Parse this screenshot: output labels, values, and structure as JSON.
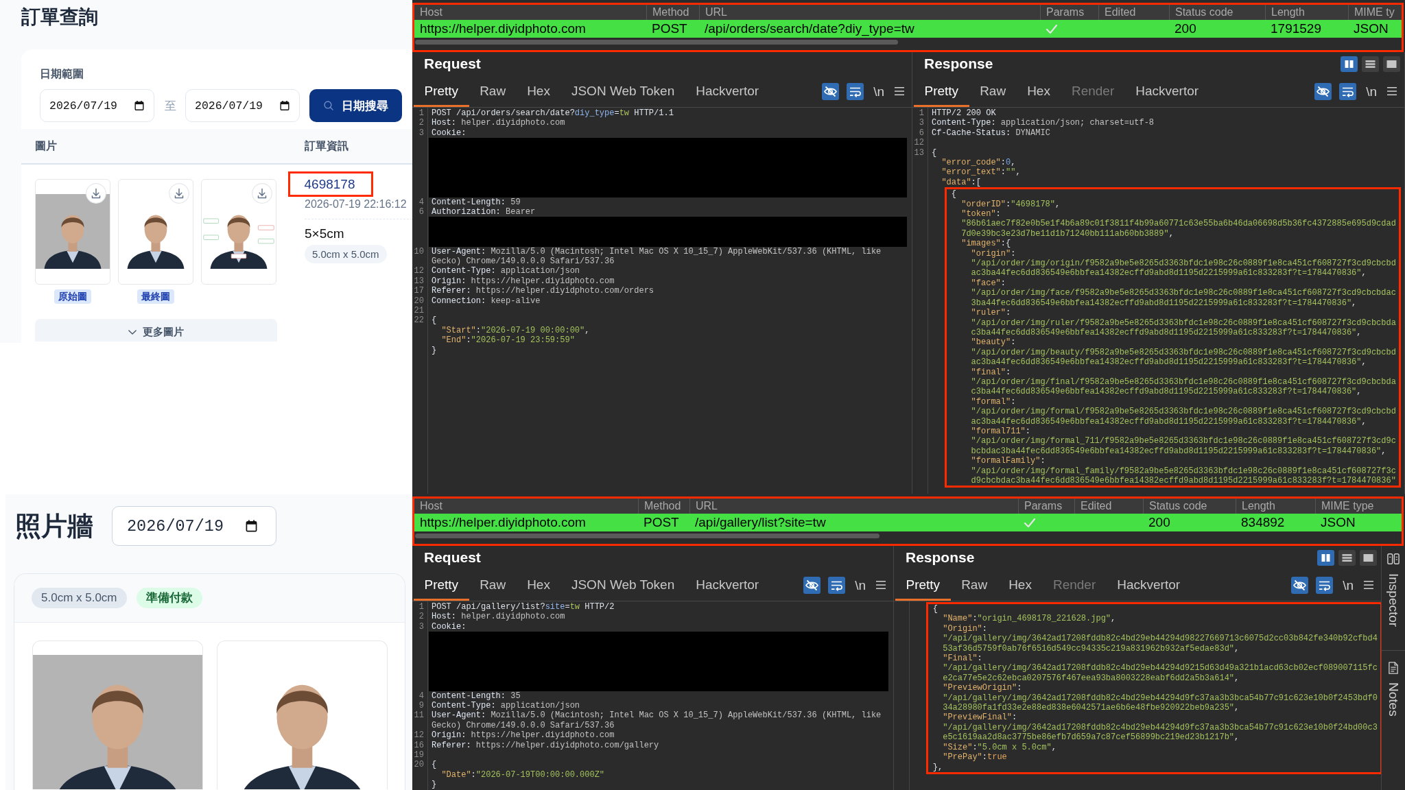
{
  "order_query": {
    "title": "訂單查詢",
    "date_range": {
      "label": "日期範圍",
      "from": "2026/07/19",
      "separator": "至",
      "to": "2026/07/19"
    },
    "search_button": "日期搜尋",
    "table": {
      "columns": [
        "圖片",
        "訂單資訊"
      ],
      "rows": [
        {
          "images": [
            {
              "kind": "original",
              "label": "原始圖"
            },
            {
              "kind": "final",
              "label": "最終圖"
            },
            {
              "kind": "ruler"
            }
          ],
          "more_button": "更多圖片",
          "order_id": "4698178",
          "highlighted": true,
          "created": "2026-07-19 22:16:12",
          "size": "5×5cm",
          "size_tag": "5.0cm x 5.0cm"
        }
      ]
    }
  },
  "photo_wall": {
    "title": "照片牆",
    "date": "2026/07/19",
    "cards": [
      {
        "size_tag": "5.0cm x 5.0cm",
        "status": "準備付款",
        "photos": [
          {
            "kind": "original"
          },
          {
            "kind": "final"
          }
        ]
      }
    ]
  },
  "captures": [
    {
      "table": {
        "highlighted": true,
        "columns": [
          "Host",
          "Method",
          "URL",
          "Params",
          "Edited",
          "Status code",
          "Length",
          "MIME ty"
        ],
        "row": {
          "color": "#44e044",
          "host": "https://helper.diyidphoto.com",
          "method": "POST",
          "url": "/api/orders/search/date?diy_type=tw",
          "params": true,
          "status": "200",
          "length": "1791529",
          "mime": "JSON"
        }
      },
      "request": {
        "title": "Request",
        "tabs": [
          {
            "label": "Pretty",
            "selected": true
          },
          {
            "label": "Raw",
            "selected": false
          },
          {
            "label": "Hex",
            "selected": false
          },
          {
            "label": "JSON Web Token",
            "selected": false
          },
          {
            "label": "Hackvertor",
            "selected": false
          }
        ],
        "toggles": [
          {
            "kind": "hide",
            "on": true
          },
          {
            "kind": "wrap",
            "on": true
          },
          {
            "kind": "newline",
            "label": "\\n",
            "on": false
          }
        ],
        "lines": [
          {
            "kind": "request_line",
            "num": "1",
            "text": "POST /api/orders/search/date?diy_type=tw HTTP/1.1"
          },
          {
            "kind": "header",
            "num": "2",
            "text": "Host: helper.diyidphoto.com"
          },
          {
            "kind": "header",
            "num": "3",
            "text": "Cookie:"
          },
          {
            "kind": "redaction",
            "tall": true
          },
          {
            "kind": "header",
            "num": "4",
            "text": "Content-Length: 59"
          },
          {
            "kind": "header",
            "num": "6",
            "text": "Authorization: Bearer"
          },
          {
            "kind": "redaction",
            "tall": false
          },
          {
            "kind": "header",
            "num": "10",
            "text": "User-Agent: Mozilla/5.0 (Macintosh; Intel Mac OS X 10_15_7) AppleWebKit/537.36 (KHTML, like Gecko) Chrome/149.0.0.0 Safari/537.36"
          },
          {
            "kind": "header",
            "num": "12",
            "text": "Content-Type: application/json"
          },
          {
            "kind": "header",
            "num": "13",
            "text": "Origin: https://helper.diyidphoto.com"
          },
          {
            "kind": "header",
            "num": "17",
            "text": "Referer: https://helper.diyidphoto.com/orders"
          },
          {
            "kind": "header",
            "num": "20",
            "text": "Connection: keep-alive"
          },
          {
            "kind": "blank",
            "num": "21"
          },
          {
            "kind": "json",
            "num": "22",
            "text": "{",
            "children": [
              {
                "kind": "json",
                "text": "\"Start\":\"2026-07-19 00:00:00\","
              },
              {
                "kind": "json",
                "text": "\"End\":\"2026-07-19 23:59:59\""
              }
            ],
            "close": "}"
          }
        ]
      },
      "response": {
        "title": "Response",
        "view_modes": [
          {
            "kind": "columns",
            "selected": true
          },
          {
            "kind": "rows",
            "selected": false
          },
          {
            "kind": "single",
            "selected": false
          }
        ],
        "tabs": [
          {
            "label": "Pretty",
            "selected": true,
            "disabled": false
          },
          {
            "label": "Raw",
            "selected": false,
            "disabled": false
          },
          {
            "label": "Hex",
            "selected": false,
            "disabled": false
          },
          {
            "label": "Render",
            "selected": false,
            "disabled": true
          },
          {
            "label": "Hackvertor",
            "selected": false,
            "disabled": false
          }
        ],
        "toggles": [
          {
            "kind": "hide",
            "on": true
          },
          {
            "kind": "wrap",
            "on": true
          },
          {
            "kind": "newline",
            "label": "\\n",
            "on": false
          }
        ],
        "lines": [
          {
            "kind": "status_line",
            "num": "1",
            "text": "HTTP/2 200 OK"
          },
          {
            "kind": "header",
            "num": "3",
            "text": "Content-Type: application/json; charset=utf-8"
          },
          {
            "kind": "header",
            "num": "6",
            "text": "Cf-Cache-Status: DYNAMIC"
          },
          {
            "kind": "blank",
            "num": "12"
          },
          {
            "kind": "json",
            "num": "13",
            "text": "{",
            "children": [
              {
                "kind": "json",
                "text": "\"error_code\":0,"
              },
              {
                "kind": "json",
                "text": "\"error_text\":\"\","
              },
              {
                "kind": "json",
                "text": "\"data\":[",
                "children": [
                  {
                    "kind": "json",
                    "text": "{",
                    "highlighted": true,
                    "children": [
                      {
                        "kind": "json",
                        "text": "\"orderID\":\"4698178\","
                      },
                      {
                        "kind": "json",
                        "text": "\"token\":"
                      },
                      {
                        "kind": "json",
                        "text": "\"86b61aec7f82e0b5e1f4b6a89c01f3811f4b99a60771c63e55ba6b46da06698d5b36fc4372885e695d9cdad7d0e39bc3e23d7be11d1b71240bb111ab60bb3889\","
                      },
                      {
                        "kind": "json",
                        "text": "\"images\":{",
                        "children": [
                          {
                            "kind": "json",
                            "text": "\"origin\":"
                          },
                          {
                            "kind": "json",
                            "text": "\"/api/order/img/origin/f9582a9be5e8265d3363bfdc1e98c26c0889f1e8ca451cf608727f3cd9cbcbdac3ba44fec6dd836549e6bbfea14382ecffd9abd8d1195d2215999a61c833283f?t=1784470836\","
                          },
                          {
                            "kind": "json",
                            "text": "\"face\":"
                          },
                          {
                            "kind": "json",
                            "text": "\"/api/order/img/face/f9582a9be5e8265d3363bfdc1e98c26c0889f1e8ca451cf608727f3cd9cbcbdac3ba44fec6dd836549e6bbfea14382ecffd9abd8d1195d2215999a61c833283f?t=1784470836\","
                          },
                          {
                            "kind": "json",
                            "text": "\"ruler\":"
                          },
                          {
                            "kind": "json",
                            "text": "\"/api/order/img/ruler/f9582a9be5e8265d3363bfdc1e98c26c0889f1e8ca451cf608727f3cd9cbcbdac3ba44fec6dd836549e6bbfea14382ecffd9abd8d1195d2215999a61c833283f?t=1784470836\","
                          },
                          {
                            "kind": "json",
                            "text": "\"beauty\":"
                          },
                          {
                            "kind": "json",
                            "text": "\"/api/order/img/beauty/f9582a9be5e8265d3363bfdc1e98c26c0889f1e8ca451cf608727f3cd9cbcbdac3ba44fec6dd836549e6bbfea14382ecffd9abd8d1195d2215999a61c833283f?t=1784470836\","
                          },
                          {
                            "kind": "json",
                            "text": "\"final\":"
                          },
                          {
                            "kind": "json",
                            "text": "\"/api/order/img/final/f9582a9be5e8265d3363bfdc1e98c26c0889f1e8ca451cf608727f3cd9cbcbdac3ba44fec6dd836549e6bbfea14382ecffd9abd8d1195d2215999a61c833283f?t=1784470836\","
                          },
                          {
                            "kind": "json",
                            "text": "\"formal\":"
                          },
                          {
                            "kind": "json",
                            "text": "\"/api/order/img/formal/f9582a9be5e8265d3363bfdc1e98c26c0889f1e8ca451cf608727f3cd9cbcbdac3ba44fec6dd836549e6bbfea14382ecffd9abd8d1195d2215999a61c833283f?t=1784470836\","
                          },
                          {
                            "kind": "json",
                            "text": "\"formal711\":"
                          },
                          {
                            "kind": "json",
                            "text": "\"/api/order/img/formal_711/f9582a9be5e8265d3363bfdc1e98c26c0889f1e8ca451cf608727f3cd9cbcbdac3ba44fec6dd836549e6bbfea14382ecffd9abd8d1195d2215999a61c833283f?t=1784470836\","
                          },
                          {
                            "kind": "json",
                            "text": "\"formalFamily\":"
                          },
                          {
                            "kind": "json",
                            "text": "\"/api/order/img/formal_family/f9582a9be5e8265d3363bfdc1e98c26c0889f1e8ca451cf608727f3cd9cbcbdac3ba44fec6dd836549e6bbfea14382ecffd9abd8d1195d2215999a61c833283f?t=1784470836\""
                          }
                        ]
                      }
                    ]
                  }
                ]
              }
            ]
          }
        ]
      }
    },
    {
      "table": {
        "highlighted": true,
        "columns": [
          "Host",
          "Method",
          "URL",
          "Params",
          "Edited",
          "Status code",
          "Length",
          "MIME type"
        ],
        "row": {
          "color": "#44e044",
          "host": "https://helper.diyidphoto.com",
          "method": "POST",
          "url": "/api/gallery/list?site=tw",
          "params": true,
          "status": "200",
          "length": "834892",
          "mime": "JSON"
        }
      },
      "request": {
        "title": "Request",
        "tabs": [
          {
            "label": "Pretty",
            "selected": true
          },
          {
            "label": "Raw",
            "selected": false
          },
          {
            "label": "Hex",
            "selected": false
          },
          {
            "label": "JSON Web Token",
            "selected": false
          },
          {
            "label": "Hackvertor",
            "selected": false
          }
        ],
        "toggles": [
          {
            "kind": "hide",
            "on": true
          },
          {
            "kind": "wrap",
            "on": true
          },
          {
            "kind": "newline",
            "label": "\\n",
            "on": false
          }
        ],
        "lines": [
          {
            "kind": "request_line",
            "num": "1",
            "text": "POST /api/gallery/list?site=tw HTTP/2"
          },
          {
            "kind": "header",
            "num": "2",
            "text": "Host: helper.diyidphoto.com"
          },
          {
            "kind": "header",
            "num": "3",
            "text": "Cookie:"
          },
          {
            "kind": "redaction",
            "tall": true
          },
          {
            "kind": "header",
            "num": "4",
            "text": "Content-Length: 35"
          },
          {
            "kind": "header",
            "num": "9",
            "text": "Content-Type: application/json"
          },
          {
            "kind": "header",
            "num": "11",
            "text": "User-Agent: Mozilla/5.0 (Macintosh; Intel Mac OS X 10_15_7) AppleWebKit/537.36 (KHTML, like Gecko) Chrome/149.0.0.0 Safari/537.36"
          },
          {
            "kind": "header",
            "num": "12",
            "text": "Origin: https://helper.diyidphoto.com"
          },
          {
            "kind": "header",
            "num": "16",
            "text": "Referer: https://helper.diyidphoto.com/gallery"
          },
          {
            "kind": "blank",
            "num": "19"
          },
          {
            "kind": "json",
            "num": "20",
            "text": "{",
            "children": [
              {
                "kind": "json",
                "text": "\"Date\":\"2026-07-19T00:00:00.000Z\""
              }
            ],
            "close": "}"
          }
        ]
      },
      "response": {
        "title": "Response",
        "view_modes": [
          {
            "kind": "columns",
            "selected": true
          },
          {
            "kind": "rows",
            "selected": false
          },
          {
            "kind": "single",
            "selected": false
          }
        ],
        "tabs": [
          {
            "label": "Pretty",
            "selected": true,
            "disabled": false
          },
          {
            "label": "Raw",
            "selected": false,
            "disabled": false
          },
          {
            "label": "Hex",
            "selected": false,
            "disabled": false
          },
          {
            "label": "Render",
            "selected": false,
            "disabled": true
          },
          {
            "label": "Hackvertor",
            "selected": false,
            "disabled": false
          }
        ],
        "toggles": [
          {
            "kind": "hide",
            "on": true
          },
          {
            "kind": "wrap",
            "on": true
          },
          {
            "kind": "newline",
            "label": "\\n",
            "on": false
          }
        ],
        "lines": [
          {
            "children": [
              {
                "children": [
                  {
                    "kind": "json",
                    "text": "{",
                    "highlighted": true,
                    "children": [
                      {
                        "kind": "json",
                        "text": "\"Name\":\"origin_4698178_221628.jpg\","
                      },
                      {
                        "kind": "json",
                        "text": "\"Origin\":"
                      },
                      {
                        "kind": "json",
                        "text": "\"/api/gallery/img/3642ad17208fddb82c4bd29eb44294d98227669713c6075d2cc03b842fe340b92cfbd453af36d5759f0ab76f6516d549cc94335c219a831962b932af5edae83d\","
                      },
                      {
                        "kind": "json",
                        "text": "\"Final\":"
                      },
                      {
                        "kind": "json",
                        "text": "\"/api/gallery/img/3642ad17208fddb82c4bd29eb44294d9215d63d49a321b1acd63cb02ecf089007115fce2ca77e5e2c62ebca0207576f467eea93ba8003228eabf6dd2a5b3a614\","
                      },
                      {
                        "kind": "json",
                        "text": "\"PreviewOrigin\":"
                      },
                      {
                        "kind": "json",
                        "text": "\"/api/gallery/img/3642ad17208fddb82c4bd29eb44294d9fc37aa3b3bca54b77c91c623e10b0f2453bdf034a28980fa1fd33e2e88ed838e6042571ae6b6e48fbe920922beb9a235\","
                      },
                      {
                        "kind": "json",
                        "text": "\"PreviewFinal\":"
                      },
                      {
                        "kind": "json",
                        "text": "\"/api/gallery/img/3642ad17208fddb82c4bd29eb44294d9fc37aa3b3bca54b77c91c623e10b0f24bd00c3e5c1619aa2d8ac3775be86efb7d659a7c87cef56899bc219ed23b1217b\","
                      },
                      {
                        "kind": "json",
                        "text": "\"Size\":\"5.0cm x 5.0cm\","
                      },
                      {
                        "kind": "json",
                        "text": "\"PrePay\":true"
                      }
                    ],
                    "close": "},"
                  }
                ]
              }
            ]
          }
        ]
      },
      "side_panel": [
        {
          "kind": "inspector",
          "label": "Inspector"
        },
        {
          "kind": "notes",
          "label": "Notes"
        }
      ]
    }
  ]
}
